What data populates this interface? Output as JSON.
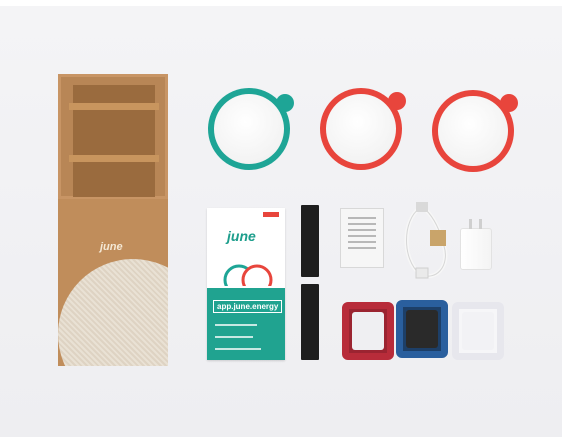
{
  "box": {
    "logo_text": "june"
  },
  "leaflet": {
    "brand": "june",
    "url": "app.june.energy"
  },
  "colors": {
    "teal": "#1ea596",
    "red": "#e8453c",
    "cardboard": "#c08d5b",
    "background": "#f0f0f3"
  },
  "icons": {
    "cable": "usb-cable-icon",
    "adapter": "power-adapter-icon"
  }
}
